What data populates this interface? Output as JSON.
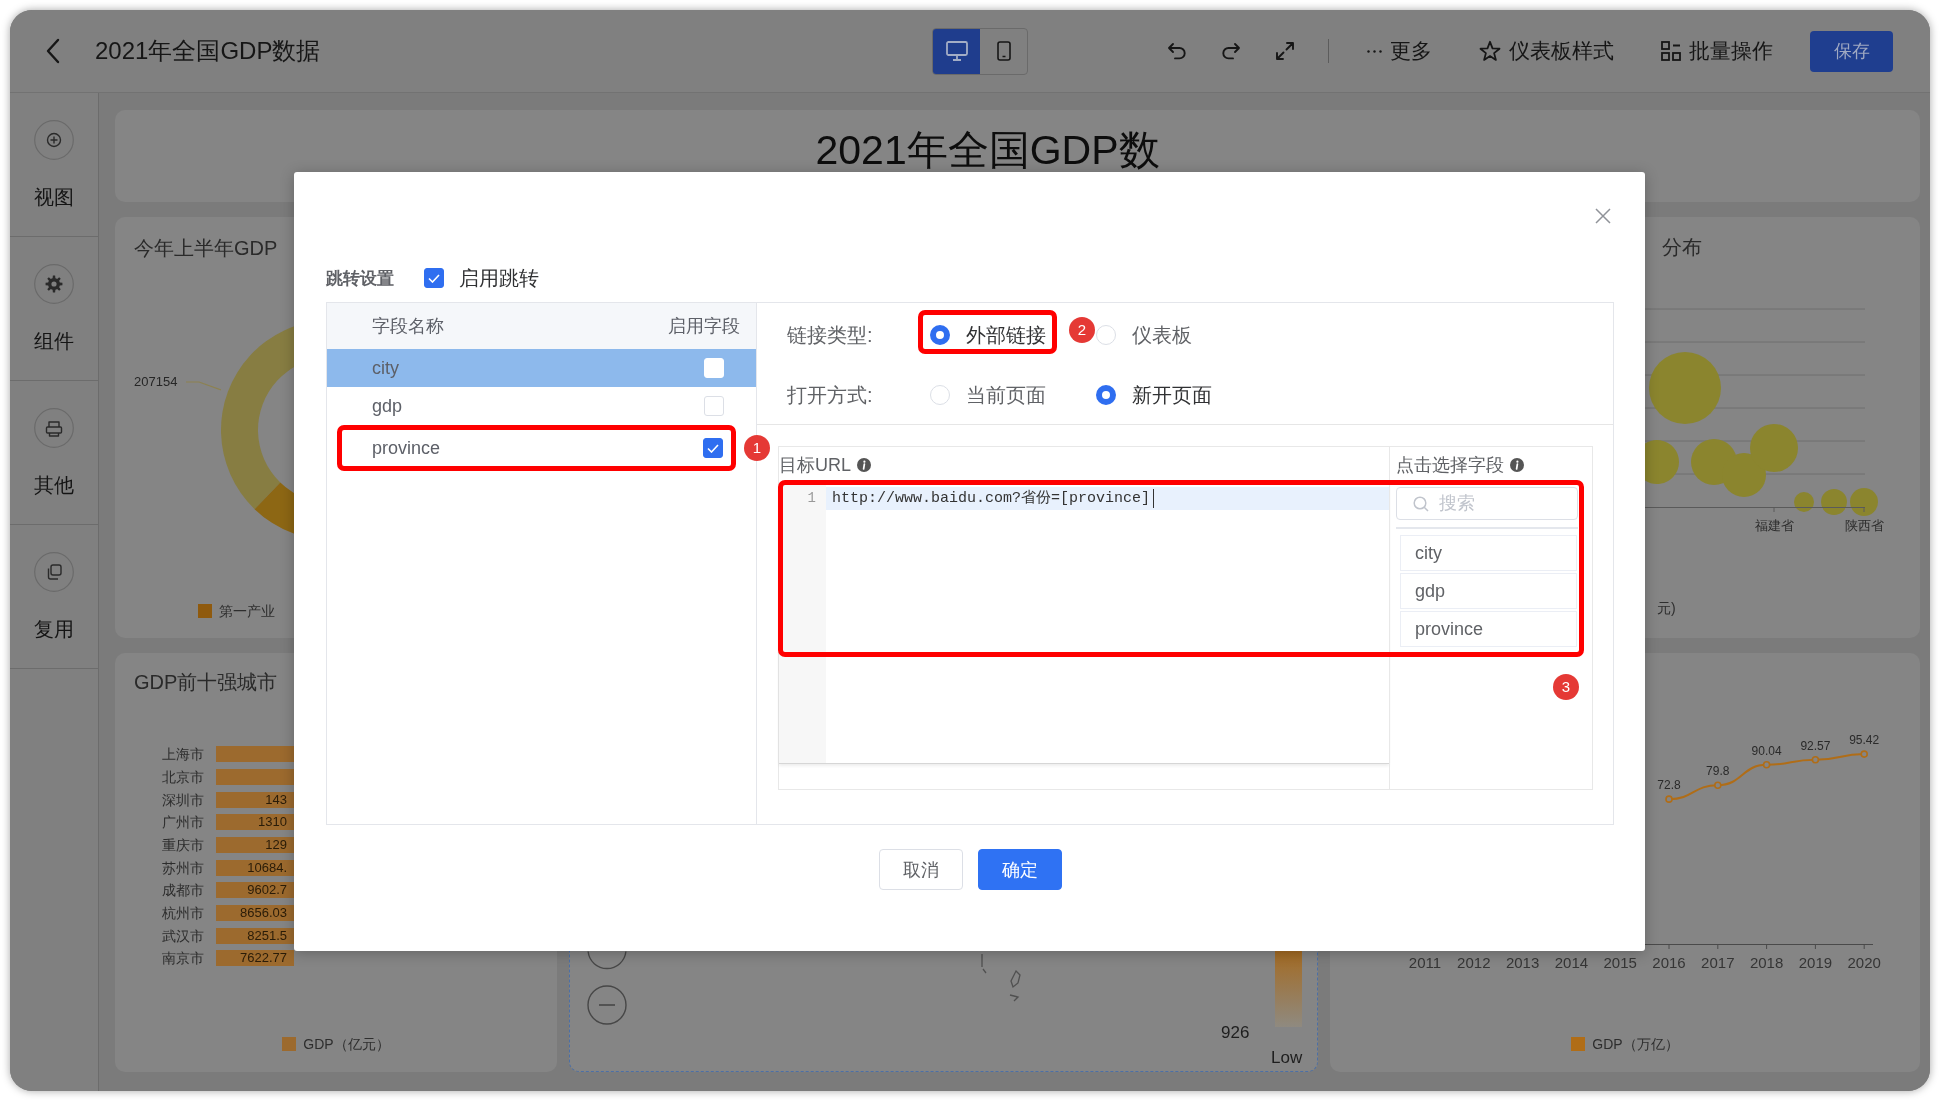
{
  "top_bar": {
    "title": "2021年全国GDP数据",
    "device_toggle": [
      {
        "kind": "desktop",
        "selected": true
      },
      {
        "kind": "mobile",
        "selected": false
      }
    ],
    "tools": [
      {
        "kind": "undo"
      },
      {
        "kind": "redo"
      },
      {
        "kind": "fullscreen"
      }
    ],
    "menus": [
      {
        "kind": "more",
        "label": "更多"
      },
      {
        "kind": "style",
        "label": "仪表板样式"
      },
      {
        "kind": "batch",
        "label": "批量操作"
      }
    ],
    "save_label": "保存"
  },
  "sidebar": {
    "items": [
      {
        "kind": "view",
        "label": "视图"
      },
      {
        "kind": "component",
        "label": "组件"
      },
      {
        "kind": "other",
        "label": "其他"
      },
      {
        "kind": "reuse",
        "label": "复用"
      }
    ]
  },
  "dashboard": {
    "title": "2021年全国GDP数",
    "donut_card": {
      "title": "今年上半年GDP",
      "value_label": "207154",
      "legend": "第一产业"
    },
    "bubble_card": {
      "title": "分布",
      "axis_labels": [
        "福建省",
        "陕西省"
      ],
      "legend": "元)"
    },
    "bar_card": {
      "title": "GDP前十强城市",
      "bars": [
        {
          "category": "上海市"
        },
        {
          "category": "北京市"
        },
        {
          "category": "深圳市",
          "value_label": "143"
        },
        {
          "category": "广州市",
          "value_label": "1310"
        },
        {
          "category": "重庆市",
          "value_label": "129"
        },
        {
          "category": "苏州市",
          "value_label": "10684."
        },
        {
          "category": "成都市",
          "value_label": "9602.7"
        },
        {
          "category": "杭州市",
          "value_label": "8656.03"
        },
        {
          "category": "武汉市",
          "value_label": "8251.5"
        },
        {
          "category": "南京市",
          "value_label": "7622.77"
        }
      ],
      "legend": "GDP（亿元）"
    },
    "map_card": {
      "selected": true,
      "value_label": "926",
      "scale_label": "Low"
    },
    "line_card": {
      "chart_data": {
        "type": "line",
        "categories": [
          "2011",
          "2012",
          "2013",
          "2014",
          "2015",
          "2016",
          "2017",
          "2018",
          "2019",
          "2020"
        ],
        "series": [
          {
            "name": "GDP（万亿）",
            "color": "#b06d17",
            "marker": "circle",
            "values": [
              null,
              null,
              null,
              null,
              null,
              72.8,
              79.8,
              90.04,
              92.57,
              95.42
            ]
          }
        ],
        "data_labels": true
      }
    }
  },
  "dialog": {
    "jump": {
      "label": "跳转设置",
      "checkbox_label": "启用跳转",
      "checked": true
    },
    "field_table": {
      "columns": [
        "字段名称",
        "启用字段"
      ],
      "rows": [
        {
          "name": "city",
          "selected": true,
          "checked": false
        },
        {
          "name": "gdp",
          "selected": false,
          "checked": false
        },
        {
          "name": "province",
          "selected": false,
          "checked": true,
          "callout": "1"
        }
      ]
    },
    "link_type": {
      "label": "链接类型:",
      "options": [
        {
          "label": "外部链接",
          "selected": true,
          "callout": "2"
        },
        {
          "label": "仪表板",
          "selected": false
        }
      ]
    },
    "open_mode": {
      "label": "打开方式:",
      "options": [
        {
          "label": "当前页面",
          "selected": false
        },
        {
          "label": "新开页面",
          "selected": true
        }
      ]
    },
    "target_url": {
      "label": "目标URL",
      "lines": [
        {
          "number": "1",
          "code": "http://www.baidu.com?省份=[province]",
          "active": true
        }
      ],
      "callout": "3"
    },
    "field_picker": {
      "label": "点击选择字段",
      "search": {
        "placeholder": "搜索"
      },
      "fields": [
        "city",
        "gdp",
        "province"
      ]
    },
    "buttons": [
      {
        "kind": "cancel",
        "label": "取消"
      },
      {
        "kind": "confirm",
        "label": "确定"
      }
    ]
  }
}
